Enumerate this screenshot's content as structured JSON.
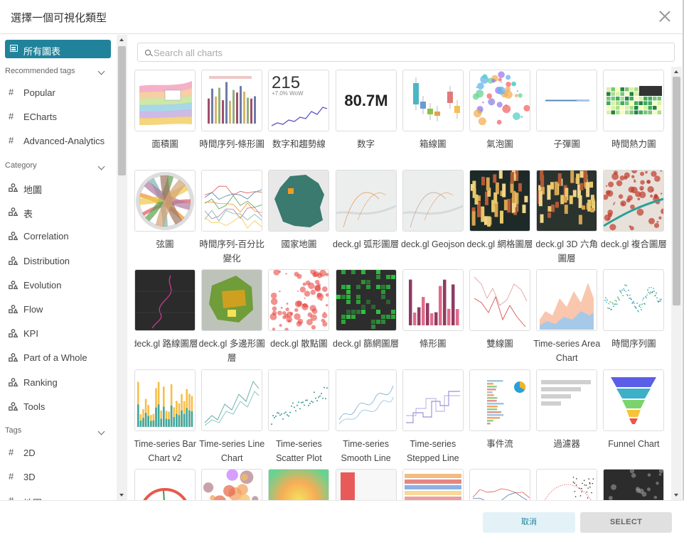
{
  "modal": {
    "title": "選擇一個可視化類型"
  },
  "sidebar": {
    "active_label": "所有圖表",
    "recommended_header": "Recommended tags",
    "recommended": [
      "Popular",
      "ECharts",
      "Advanced-Analytics"
    ],
    "category_header": "Category",
    "categories": [
      "地圖",
      "表",
      "Correlation",
      "Distribution",
      "Evolution",
      "Flow",
      "KPI",
      "Part of a Whole",
      "Ranking",
      "Tools"
    ],
    "tags_header": "Tags",
    "tags": [
      "2D",
      "3D",
      "地圖"
    ]
  },
  "search": {
    "placeholder": "Search all charts",
    "value": ""
  },
  "charts": [
    {
      "label": "面積圖",
      "icon": "area-chart-thumbnail"
    },
    {
      "label": "時間序列-條形圖",
      "icon": "time-series-bar-thumbnail"
    },
    {
      "label": "数字和趨勢線",
      "icon": "big-number-trendline-thumbnail",
      "big_number": "215",
      "subtext": "+7.0% WoW"
    },
    {
      "label": "数字",
      "icon": "big-number-thumbnail",
      "big_number": "80.7M"
    },
    {
      "label": "箱線圖",
      "icon": "box-plot-thumbnail"
    },
    {
      "label": "氣泡圖",
      "icon": "bubble-chart-thumbnail"
    },
    {
      "label": "子彈圖",
      "icon": "bullet-chart-thumbnail"
    },
    {
      "label": "時間熱力圖",
      "icon": "calendar-heatmap-thumbnail"
    },
    {
      "label": "弦圖",
      "icon": "chord-diagram-thumbnail"
    },
    {
      "label": "時間序列-百分比變化",
      "icon": "time-series-percent-change-thumbnail"
    },
    {
      "label": "國家地圖",
      "icon": "country-map-thumbnail"
    },
    {
      "label": "deck.gl 弧形圖層",
      "icon": "deckgl-arc-thumbnail"
    },
    {
      "label": "deck.gl Geojson",
      "icon": "deckgl-geojson-thumbnail"
    },
    {
      "label": "deck.gl 網格圖層",
      "icon": "deckgl-grid-thumbnail"
    },
    {
      "label": "deck.gl 3D 六角圖層",
      "icon": "deckgl-hex-thumbnail"
    },
    {
      "label": "deck.gl 複合圖層",
      "icon": "deckgl-multi-thumbnail"
    },
    {
      "label": "deck.gl 路線圖層",
      "icon": "deckgl-path-thumbnail"
    },
    {
      "label": "deck.gl 多邊形圖層",
      "icon": "deckgl-polygon-thumbnail"
    },
    {
      "label": "deck.gl 散點圖",
      "icon": "deckgl-scatter-thumbnail"
    },
    {
      "label": "deck.gl 篩網圖層",
      "icon": "deckgl-screengrid-thumbnail"
    },
    {
      "label": "條形圖",
      "icon": "bar-chart-thumbnail"
    },
    {
      "label": "雙線圖",
      "icon": "dual-line-thumbnail"
    },
    {
      "label": "Time-series Area Chart",
      "icon": "ts-area-thumbnail"
    },
    {
      "label": "時間序列圖",
      "icon": "time-series-thumbnail"
    },
    {
      "label": "Time-series Bar Chart v2",
      "icon": "ts-bar-v2-thumbnail"
    },
    {
      "label": "Time-series Line Chart",
      "icon": "ts-line-thumbnail"
    },
    {
      "label": "Time-series Scatter Plot",
      "icon": "ts-scatter-thumbnail"
    },
    {
      "label": "Time-series Smooth Line",
      "icon": "ts-smooth-thumbnail"
    },
    {
      "label": "Time-series Stepped Line",
      "icon": "ts-stepped-thumbnail"
    },
    {
      "label": "事件流",
      "icon": "event-flow-thumbnail"
    },
    {
      "label": "過濾器",
      "icon": "filter-box-thumbnail"
    },
    {
      "label": "Funnel Chart",
      "icon": "funnel-chart-thumbnail"
    },
    {
      "label": "",
      "icon": "gauge-thumbnail"
    },
    {
      "label": "",
      "icon": "bubble-pack-thumbnail"
    },
    {
      "label": "",
      "icon": "heatmap-thumbnail"
    },
    {
      "label": "",
      "icon": "histogram-thumbnail"
    },
    {
      "label": "",
      "icon": "horizon-thumbnail"
    },
    {
      "label": "",
      "icon": "line-multi-thumbnail"
    },
    {
      "label": "",
      "icon": "scatter-line-thumbnail"
    },
    {
      "label": "",
      "icon": "mapbox-thumbnail"
    }
  ],
  "footer": {
    "cancel_label": "取消",
    "select_label": "SELECT"
  },
  "colors": {
    "accent": "#20839b",
    "cancel_bg": "#e3f2f7",
    "select_bg": "#e0e0e0"
  }
}
